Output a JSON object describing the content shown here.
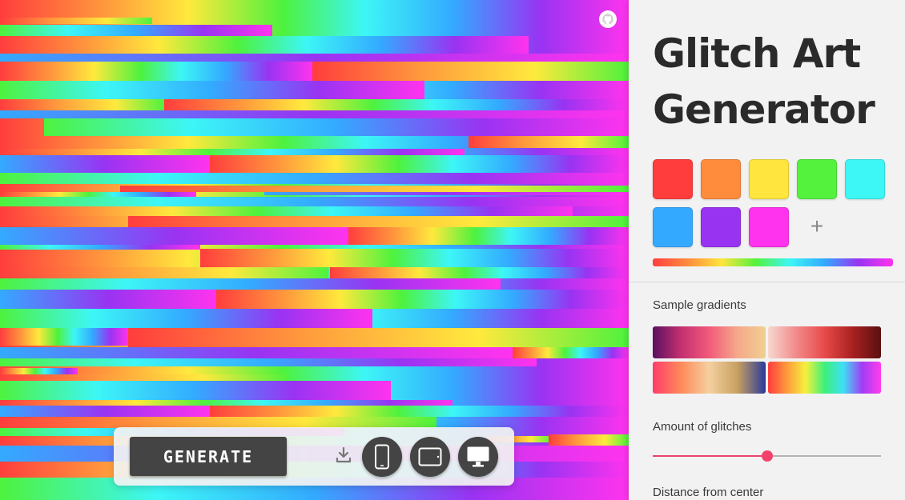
{
  "app": {
    "title": "Glitch Art Generator"
  },
  "controls": {
    "generate_label": "GENERATE"
  },
  "palette": {
    "colors": [
      "#ff3d3d",
      "#ff8b3d",
      "#ffe53d",
      "#54f23d",
      "#3df6f6",
      "#33aaff",
      "#9933f2",
      "#ff33ee"
    ],
    "add_label": "+"
  },
  "sample_gradients": {
    "label": "Sample gradients",
    "items": [
      [
        "#5a1060",
        "#c43070",
        "#f25a7a",
        "#f5a88a",
        "#f0d090"
      ],
      [
        "#f7d8d0",
        "#f28a8a",
        "#e84a4a",
        "#a82020",
        "#5a1010"
      ],
      [
        "#ff3d6a",
        "#ff8a5a",
        "#f5d0a0",
        "#c8a060",
        "#2a3a9a"
      ],
      [
        "#ff3d3d",
        "#ff9a3d",
        "#f5f03d",
        "#3df07a",
        "#3de0f5",
        "#a03df5",
        "#ff3dee"
      ]
    ]
  },
  "glitch_amount": {
    "label": "Amount of glitches",
    "value": 0.5
  },
  "distance": {
    "label": "Distance from center"
  },
  "icons": {
    "github": "github-icon",
    "download": "download-icon",
    "mobile": "phone-icon",
    "tablet": "tablet-icon",
    "desktop": "monitor-icon"
  }
}
